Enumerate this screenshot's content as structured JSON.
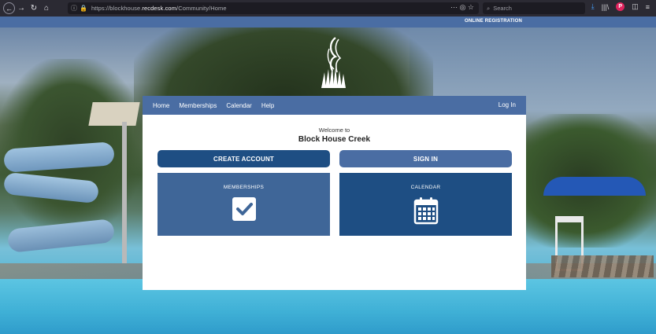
{
  "browser": {
    "url_prefix": "https://blockhouse.",
    "url_domain": "recdesk.com",
    "url_path": "/Community/Home",
    "url_tools": "··· ◎ ☆",
    "search_placeholder": "Search"
  },
  "topstrip": {
    "online_registration": "ONLINE REGISTRATION"
  },
  "nav": {
    "items": [
      "Home",
      "Memberships",
      "Calendar",
      "Help"
    ],
    "login": "Log In"
  },
  "welcome": {
    "line1": "Welcome to",
    "site_name": "Block House Creek"
  },
  "buttons": {
    "create_account": "CREATE ACCOUNT",
    "sign_in": "SIGN IN"
  },
  "tiles": {
    "memberships": "MEMBERSHIPS",
    "calendar": "CALENDAR"
  },
  "colors": {
    "brand_blue": "#4a6da3",
    "dark_blue": "#1e4e83"
  }
}
